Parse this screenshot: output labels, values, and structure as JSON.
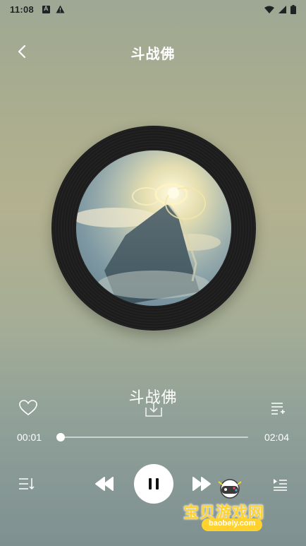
{
  "status_bar": {
    "time": "11:08"
  },
  "header": {
    "title": "斗战佛"
  },
  "player": {
    "song_title": "斗战佛",
    "current_time": "00:01",
    "total_time": "02:04",
    "progress_fraction": 0.008
  },
  "watermark": {
    "text": "宝贝游戏网",
    "url": "baobeiy.com"
  },
  "icons": {
    "back": "chevron-left-icon",
    "like": "heart-icon",
    "download": "download-icon",
    "add_to_playlist": "playlist-add-icon",
    "play_mode": "sort-list-icon",
    "previous": "rewind-icon",
    "pause": "pause-icon",
    "next": "fast-forward-icon",
    "queue": "queue-list-icon"
  },
  "colors": {
    "accent": "#ffffff",
    "vinyl": "#1c1c1c",
    "watermark": "#ffd22e"
  }
}
